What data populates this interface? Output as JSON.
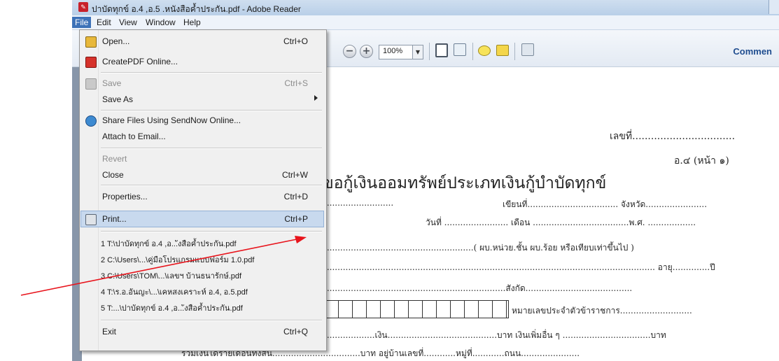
{
  "window": {
    "title": "ปาบัดทุกข์ อ.4 ,อ.5 .หนังสือค้ำประกัน.pdf - Adobe Reader",
    "app_icon": "adobe-pdf-icon"
  },
  "menubar": [
    "File",
    "Edit",
    "View",
    "Window",
    "Help"
  ],
  "toolbar": {
    "zoom_value": "100%",
    "comment_label": "Commen"
  },
  "file_menu": {
    "items": [
      {
        "label": "Open...",
        "mnemonic": "O",
        "shortcut": "Ctrl+O",
        "icon": "folder-open-icon",
        "enabled": true
      },
      {
        "label": "CreatePDF Online...",
        "shortcut": "",
        "icon": "createpdf-icon",
        "enabled": true
      },
      {
        "label": "Save",
        "shortcut": "Ctrl+S",
        "icon": "save-icon",
        "enabled": false
      },
      {
        "label": "Save As",
        "shortcut": "",
        "submenu": true,
        "enabled": true
      },
      {
        "label": "Share Files Using SendNow Online...",
        "shortcut": "",
        "icon": "share-icon",
        "enabled": true
      },
      {
        "label": "Attach to Email...",
        "shortcut": "",
        "enabled": true
      },
      {
        "label": "Revert",
        "shortcut": "",
        "enabled": false
      },
      {
        "label": "Close",
        "shortcut": "Ctrl+W",
        "enabled": true
      },
      {
        "label": "Properties...",
        "shortcut": "Ctrl+D",
        "enabled": true
      },
      {
        "label": "Print...",
        "shortcut": "Ctrl+P",
        "icon": "printer-icon",
        "enabled": true,
        "highlighted": true
      }
    ],
    "recent_files": [
      "1 T:\\ปาบัดทุกข์ อ.4 ,อ...ังสือค้ำประกัน.pdf",
      "2 C:\\Users\\...\\คู่มือโปรแกรมแบบฟอร์ม 1.0.pdf",
      "3 C:\\Users\\TOM\\...\\เลขฯ บ้านธนารักษ์.pdf",
      "4 T:\\ร.อ.อันญะ\\...\\เคหสงเคราะห์ อ.4, อ.5.pdf",
      "5 T:...\\ปาบัดทุกข์ อ.4 ,อ...ังสือค้ำประกัน.pdf"
    ],
    "exit": {
      "label": "Exit",
      "shortcut": "Ctrl+Q"
    }
  },
  "document": {
    "number_label": "เลขที่.................................",
    "page_ref": "อ.๔ (หน้า ๑)",
    "heading": "ขอกู้เงินออมทรัพย์ประเภทเงินกู้บำบัดทุกข์",
    "line1_a": "..........................",
    "line1_b": "เขียนที่.................................. จังหวัด.......................",
    "line2": "วันที่ ........................ เดือน ....................................พ.ศ. ..................",
    "line3": "........................................................( ผบ.หน่วย.ชั้น   ผบ.ร้อย  หรือเทียบเท่าขึ้นไป )",
    "line4": "............................................................................................................................ อายุ..............ปี",
    "line5": "....................................................................สังกัด........................................",
    "line6": "หมายเลขประจำตัวข้าราชการ...........................",
    "line7": "...................เงิน.........................................บาท  เงินเพิ่มอื่น ๆ .................................บาท",
    "line8": "รวมเงินได้รายเดือนทั้งสิ้น.................................บาท อยู่บ้านเลขที่............หมู่ที่............ถนน......................"
  },
  "colors": {
    "accent": "#3d72b8",
    "highlight": "#c8d9ee",
    "arrow": "#e8141c"
  }
}
